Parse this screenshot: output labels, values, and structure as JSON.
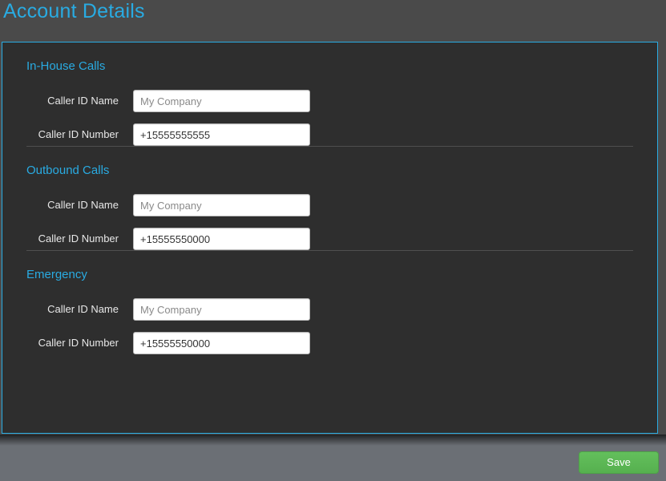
{
  "page": {
    "title": "Account Details"
  },
  "panel": {
    "accent_color": "#29abe2",
    "background_color": "#2e2e2e",
    "sections": [
      {
        "title": "In-House Calls",
        "fields": [
          {
            "label": "Caller ID Name",
            "value": "",
            "placeholder": "My Company"
          },
          {
            "label": "Caller ID Number",
            "value": "+15555555555",
            "placeholder": ""
          }
        ]
      },
      {
        "title": "Outbound Calls",
        "fields": [
          {
            "label": "Caller ID Name",
            "value": "",
            "placeholder": "My Company"
          },
          {
            "label": "Caller ID Number",
            "value": "+15555550000",
            "placeholder": ""
          }
        ]
      },
      {
        "title": "Emergency",
        "fields": [
          {
            "label": "Caller ID Name",
            "value": "",
            "placeholder": "My Company"
          },
          {
            "label": "Caller ID Number",
            "value": "+15555550000",
            "placeholder": ""
          }
        ]
      }
    ]
  },
  "footer": {
    "save_label": "Save",
    "save_color": "#5cb85c"
  }
}
